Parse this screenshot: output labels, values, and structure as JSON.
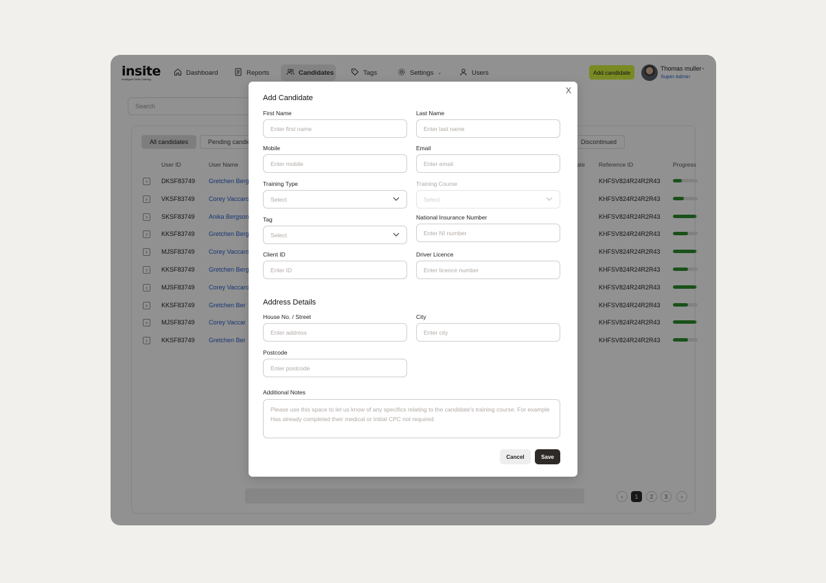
{
  "logo": {
    "word": "insite",
    "tagline": "Intelligent Skills Training"
  },
  "nav": {
    "dashboard": "Dashboard",
    "reports": "Reports",
    "candidates": "Candidates",
    "tags": "Tags",
    "settings": "Settings",
    "users": "Users"
  },
  "header": {
    "add_candidate": "Add candidate",
    "user_name": "Thomas muller",
    "user_role": "Super Admin"
  },
  "search": {
    "placeholder": "Search"
  },
  "tabs": {
    "all": "All candidates",
    "pending": "Pending candida",
    "discontinued": "Discontinued"
  },
  "table": {
    "headers": {
      "user_id": "User ID",
      "user_name": "User Name",
      "date": "ate",
      "reference_id": "Reference ID",
      "progress": "Progress"
    },
    "rows": [
      {
        "user_id": "DKSF83749",
        "user_name": "Gretchen Bergs",
        "ref": "KHFSV824R24R2R43",
        "progress": 0.35
      },
      {
        "user_id": "VKSF83749",
        "user_name": "Corey Vaccaro",
        "ref": "KHFSV824R24R2R43",
        "progress": 0.45
      },
      {
        "user_id": "SKSF83749",
        "user_name": "Anika Bergson",
        "ref": "KHFSV824R24R2R43",
        "progress": 0.95
      },
      {
        "user_id": "KKSF83749",
        "user_name": "Gretchen Bergs",
        "ref": "KHFSV824R24R2R43",
        "progress": 0.6
      },
      {
        "user_id": "MJSF83749",
        "user_name": "Corey Vaccaro",
        "ref": "KHFSV824R24R2R43",
        "progress": 0.95
      },
      {
        "user_id": "KKSF83749",
        "user_name": "Gretchen Bergs",
        "ref": "KHFSV824R24R2R43",
        "progress": 0.6
      },
      {
        "user_id": "MJSF83749",
        "user_name": "Corey Vaccaro",
        "ref": "KHFSV824R24R2R43",
        "progress": 0.95
      },
      {
        "user_id": "KKSF83749",
        "user_name": "Gretchen Ber",
        "ref": "KHFSV824R24R2R43",
        "progress": 0.6
      },
      {
        "user_id": "MJSF83749",
        "user_name": "Corey Vaccar",
        "ref": "KHFSV824R24R2R43",
        "progress": 0.95
      },
      {
        "user_id": "KKSF83749",
        "user_name": "Gretchen Ber",
        "ref": "KHFSV824R24R2R43",
        "progress": 0.6
      }
    ]
  },
  "pagination": {
    "pages": [
      "1",
      "2",
      "3"
    ],
    "current": "1",
    "prev": "‹",
    "next": "›"
  },
  "modal": {
    "title": "Add Candidate",
    "close": "X",
    "first_name": {
      "label": "First Name",
      "placeholder": "Enter first name"
    },
    "last_name": {
      "label": "Last Name",
      "placeholder": "Enter last name"
    },
    "mobile": {
      "label": "Mobile",
      "placeholder": "Enter mobile"
    },
    "email": {
      "label": "Email",
      "placeholder": "Enter email"
    },
    "training_type": {
      "label": "Training Type",
      "placeholder": "Select"
    },
    "training_course": {
      "label": "Training Course",
      "placeholder": "Select"
    },
    "tag": {
      "label": "Tag",
      "placeholder": "Select"
    },
    "ni_number": {
      "label": "National Insurance Number",
      "placeholder": "Enter NI number"
    },
    "client_id": {
      "label": "Client ID",
      "placeholder": "Enter ID"
    },
    "driver_licence": {
      "label": "Driver Licence",
      "placeholder": "Enter licence number"
    },
    "address_title": "Address Details",
    "house": {
      "label": "House No. / Street",
      "placeholder": "Enter address"
    },
    "city": {
      "label": "City",
      "placeholder": "Enter city"
    },
    "postcode": {
      "label": "Postcode",
      "placeholder": "Enter postcode"
    },
    "notes": {
      "label": "Additional Notes",
      "placeholder": "Please use this space to let us know of any specifics relating to the candidate's training course. For example Has already completed their medical or Initial CPC not required"
    },
    "cancel": "Cancel",
    "save": "Save"
  },
  "colors": {
    "accent": "#d6f23f",
    "link": "#2a61c9",
    "progress": "#2f8f2f",
    "save_button": "#2e2a27"
  }
}
